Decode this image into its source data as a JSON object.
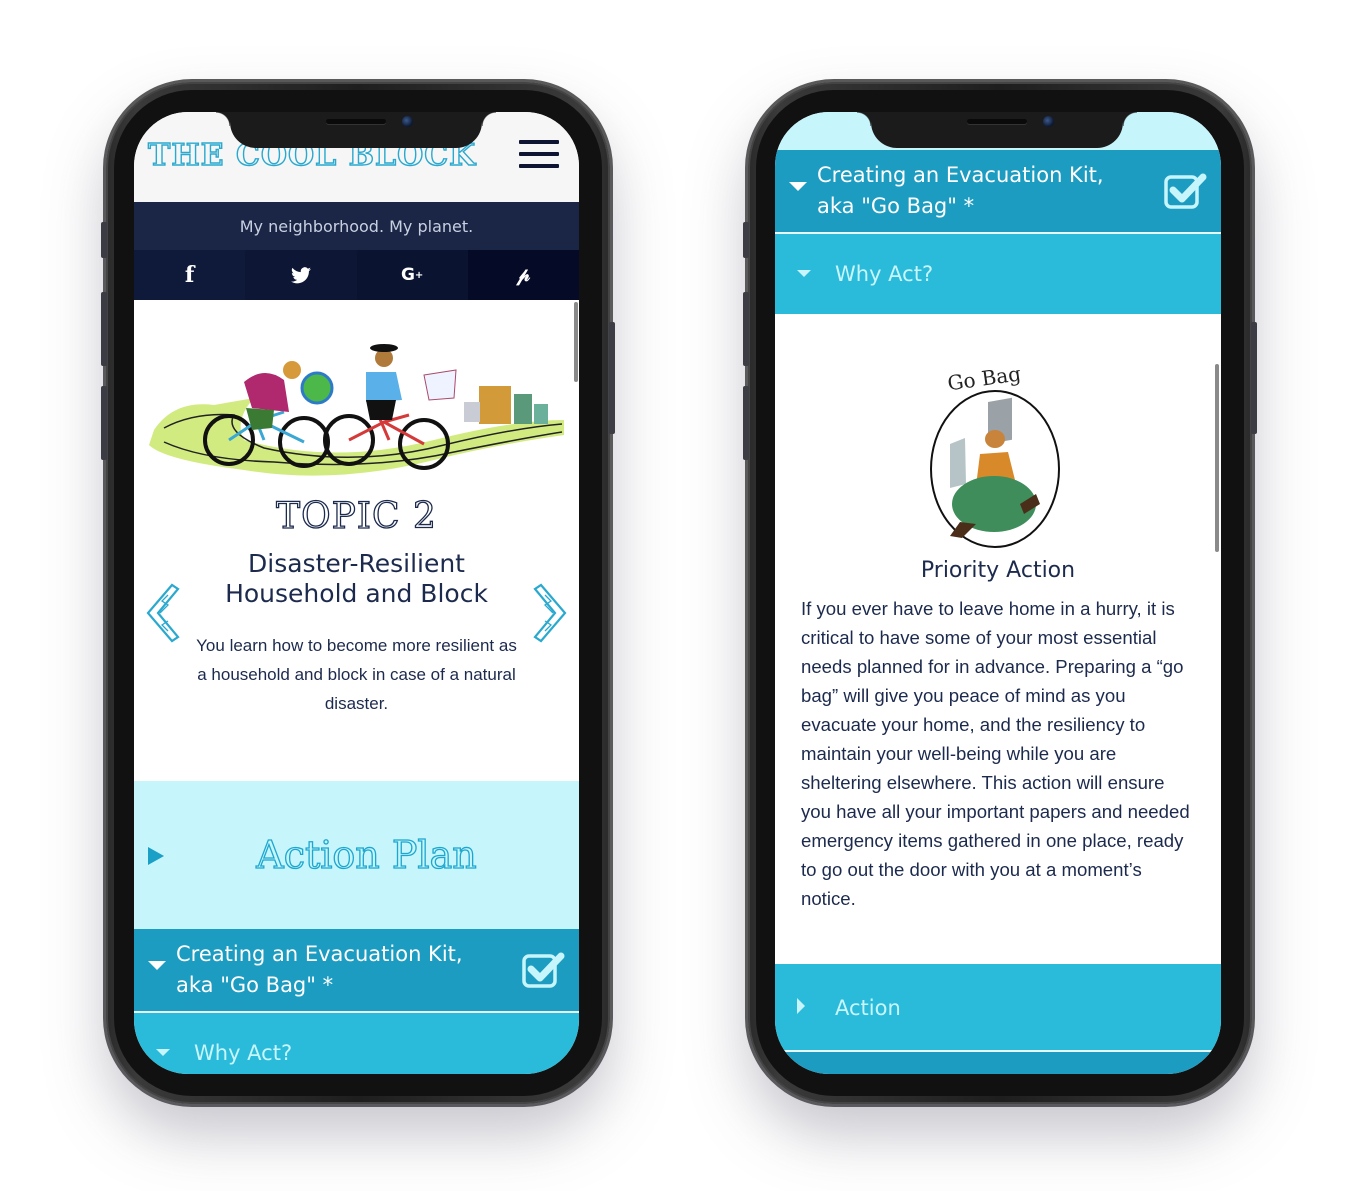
{
  "left_phone": {
    "header": {
      "logo": "THE COOL BLOCK",
      "menu_icon": "hamburger-icon"
    },
    "tagline": "My neighborhood. My planet.",
    "social": [
      {
        "icon": "facebook-icon",
        "glyph": "f"
      },
      {
        "icon": "twitter-icon",
        "glyph": "🐦"
      },
      {
        "icon": "google-plus-icon",
        "glyph": "G+"
      },
      {
        "icon": "pinterest-icon",
        "glyph": "P"
      }
    ],
    "hero_image": "cyclists-illustration",
    "topic": {
      "label": "TOPIC 2",
      "title_line1": "Disaster-Resilient",
      "title_line2": "Household and Block",
      "description": "You learn how to become more resilient as a household and block in case of a natural disaster.",
      "prev_icon": "chevron-left-icon",
      "next_icon": "chevron-right-icon"
    },
    "action_plan": {
      "title": "Action Plan",
      "expanded": false
    },
    "accordion": {
      "title_line1": "Creating an Evacuation Kit,",
      "title_line2": "aka \"Go Bag\" *",
      "checked": true,
      "sub": {
        "label": "Why Act?",
        "expanded": true
      }
    }
  },
  "right_phone": {
    "accordion": {
      "title_line1": "Creating an Evacuation Kit,",
      "title_line2": "aka \"Go Bag\" *",
      "checked": true,
      "sub": {
        "label": "Why Act?",
        "expanded": true
      }
    },
    "go_bag": {
      "image_caption": "Go Bag",
      "heading": "Priority Action",
      "body": "If you ever have to leave home in a hurry, it is critical to have some of your most essential needs planned for in advance. Preparing a “go bag” will give you peace of mind as you evacuate your home, and the resiliency to maintain your well-being while you are sheltering elsewhere. This action will ensure you have all your important papers and needed emergency items gathered in one place, ready to go out the door with you at a moment’s notice."
    },
    "action_section": {
      "label": "Action",
      "expanded": false
    }
  },
  "colors": {
    "brand_cyan": "#2aa9cf",
    "navy": "#1c2a4d",
    "accordion_dark": "#1d9cc1",
    "accordion_light": "#2abbda",
    "pale_cyan": "#c6f5fc"
  }
}
